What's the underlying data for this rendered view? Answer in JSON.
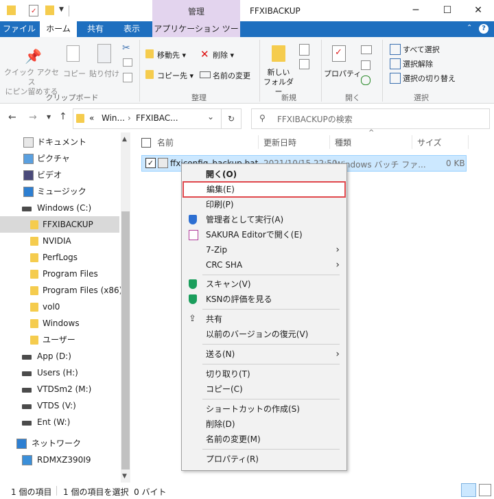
{
  "window": {
    "title": "FFXIBACKUP",
    "context_tab_label": "管理",
    "minimize": "─",
    "maximize": "☐",
    "close": "✕"
  },
  "tabs": [
    "ファイル",
    "ホーム",
    "共有",
    "表示",
    "アプリケーション ツール"
  ],
  "ribbon": {
    "clipboard": {
      "pin": "クイック アクセス にピン留めする",
      "pin_l1": "クイック アクセス",
      "pin_l2": "にピン留めする",
      "copy": "コピー",
      "paste": "貼り付け",
      "group": "クリップボード"
    },
    "organize": {
      "move": "移動先",
      "copy_to": "コピー先",
      "delete": "削除",
      "rename": "名前の変更",
      "group": "整理"
    },
    "new": {
      "folder_l1": "新しい",
      "folder_l2": "フォルダー",
      "group": "新規"
    },
    "open": {
      "properties": "プロパティ",
      "group": "開く"
    },
    "select": {
      "all": "すべて選択",
      "none": "選択解除",
      "invert": "選択の切り替え",
      "group": "選択"
    }
  },
  "address": {
    "breadcrumb_prefix": "«",
    "crumb1": "Win...",
    "crumb2": "FFXIBAC...",
    "search_placeholder": "FFXIBACKUPの検索"
  },
  "nav": {
    "items": [
      {
        "label": "ドキュメント",
        "icon": "document-icon"
      },
      {
        "label": "ピクチャ",
        "icon": "pictures-icon"
      },
      {
        "label": "ビデオ",
        "icon": "video-icon"
      },
      {
        "label": "ミュージック",
        "icon": "music-icon"
      },
      {
        "label": "Windows (C:)",
        "icon": "drive-icon"
      },
      {
        "label": "FFXIBACKUP",
        "icon": "folder-icon"
      },
      {
        "label": "NVIDIA",
        "icon": "folder-icon"
      },
      {
        "label": "PerfLogs",
        "icon": "folder-icon"
      },
      {
        "label": "Program Files",
        "icon": "folder-icon"
      },
      {
        "label": "Program Files (x86)",
        "icon": "folder-icon"
      },
      {
        "label": "vol0",
        "icon": "folder-icon"
      },
      {
        "label": "Windows",
        "icon": "folder-icon"
      },
      {
        "label": "ユーザー",
        "icon": "folder-icon"
      },
      {
        "label": "App (D:)",
        "icon": "drive-icon"
      },
      {
        "label": "Users (H:)",
        "icon": "drive-icon"
      },
      {
        "label": "VTDSm2 (M:)",
        "icon": "drive-icon"
      },
      {
        "label": "VTDS (V:)",
        "icon": "drive-icon"
      },
      {
        "label": "Ent (W:)",
        "icon": "drive-icon"
      },
      {
        "label": "ネットワーク",
        "icon": "network-icon"
      },
      {
        "label": "RDMXZ390I9",
        "icon": "computer-icon"
      }
    ]
  },
  "columns": {
    "name": "名前",
    "modified": "更新日時",
    "type": "種類",
    "size": "サイズ"
  },
  "file": {
    "name": "ffxiconfig_backup.bat",
    "modified": "2021/10/15 22:50",
    "type": "Windows バッチ ファ...",
    "size": "0 KB"
  },
  "context_menu": {
    "open": "開く(O)",
    "edit": "編集(E)",
    "print": "印刷(P)",
    "run_as_admin": "管理者として実行(A)",
    "sakura": "SAKURA Editorで開く(E)",
    "sevenzip": "7-Zip",
    "crc": "CRC SHA",
    "scan": "スキャン(V)",
    "ksn": "KSNの評価を見る",
    "share": "共有",
    "restore": "以前のバージョンの復元(V)",
    "sendto": "送る(N)",
    "cut": "切り取り(T)",
    "copy": "コピー(C)",
    "shortcut": "ショートカットの作成(S)",
    "delete": "削除(D)",
    "rename": "名前の変更(M)",
    "properties": "プロパティ(R)"
  },
  "status": {
    "count": "1 個の項目",
    "selected": "1 個の項目を選択  0 バイト"
  },
  "colors": {
    "tab_bar": "#1e6fbf",
    "context_tab": "#e3d4ee",
    "selection": "#cce8ff",
    "highlight_box": "#e0474c",
    "folder": "#f5cc4e"
  }
}
